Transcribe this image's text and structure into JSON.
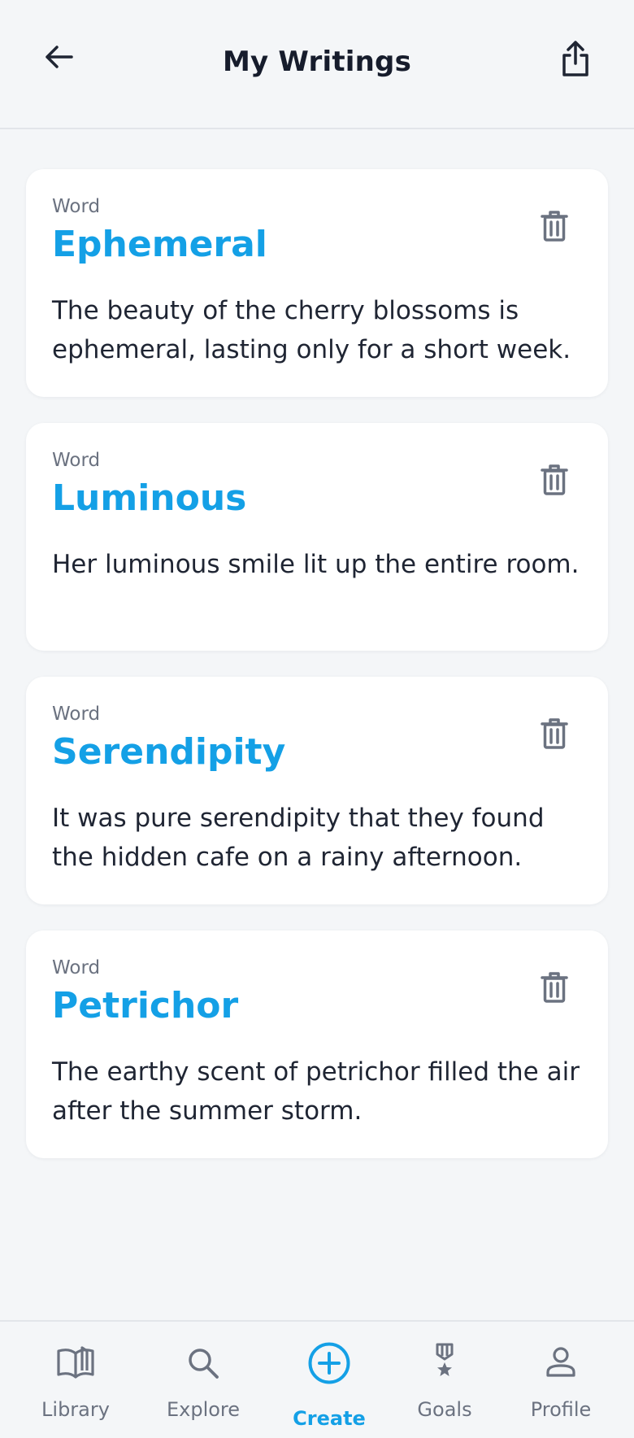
{
  "header": {
    "title": "My Writings",
    "back_icon": "arrow-left-icon",
    "share_icon": "share-icon"
  },
  "writings": [
    {
      "label": "Word",
      "word": "Ephemeral",
      "sentence": "The beauty of the cherry blossoms is ephemeral, lasting only for a short week."
    },
    {
      "label": "Word",
      "word": "Luminous",
      "sentence": "Her luminous smile lit up the entire room."
    },
    {
      "label": "Word",
      "word": "Serendipity",
      "sentence": "It was pure serendipity that they found the hidden cafe on a rainy afternoon."
    },
    {
      "label": "Word",
      "word": "Petrichor",
      "sentence": "The earthy scent of petrichor filled the air after the summer storm."
    }
  ],
  "nav": {
    "items": [
      {
        "label": "Library",
        "icon": "book-open-icon"
      },
      {
        "label": "Explore",
        "icon": "search-icon"
      },
      {
        "label": "Create",
        "icon": "plus-circle-icon",
        "active": true
      },
      {
        "label": "Goals",
        "icon": "medal-icon"
      },
      {
        "label": "Profile",
        "icon": "user-icon"
      }
    ]
  },
  "colors": {
    "accent": "#14a0e6",
    "background": "#f4f6f8",
    "card": "#ffffff",
    "muted": "#6b7280",
    "text": "#1f2533"
  }
}
